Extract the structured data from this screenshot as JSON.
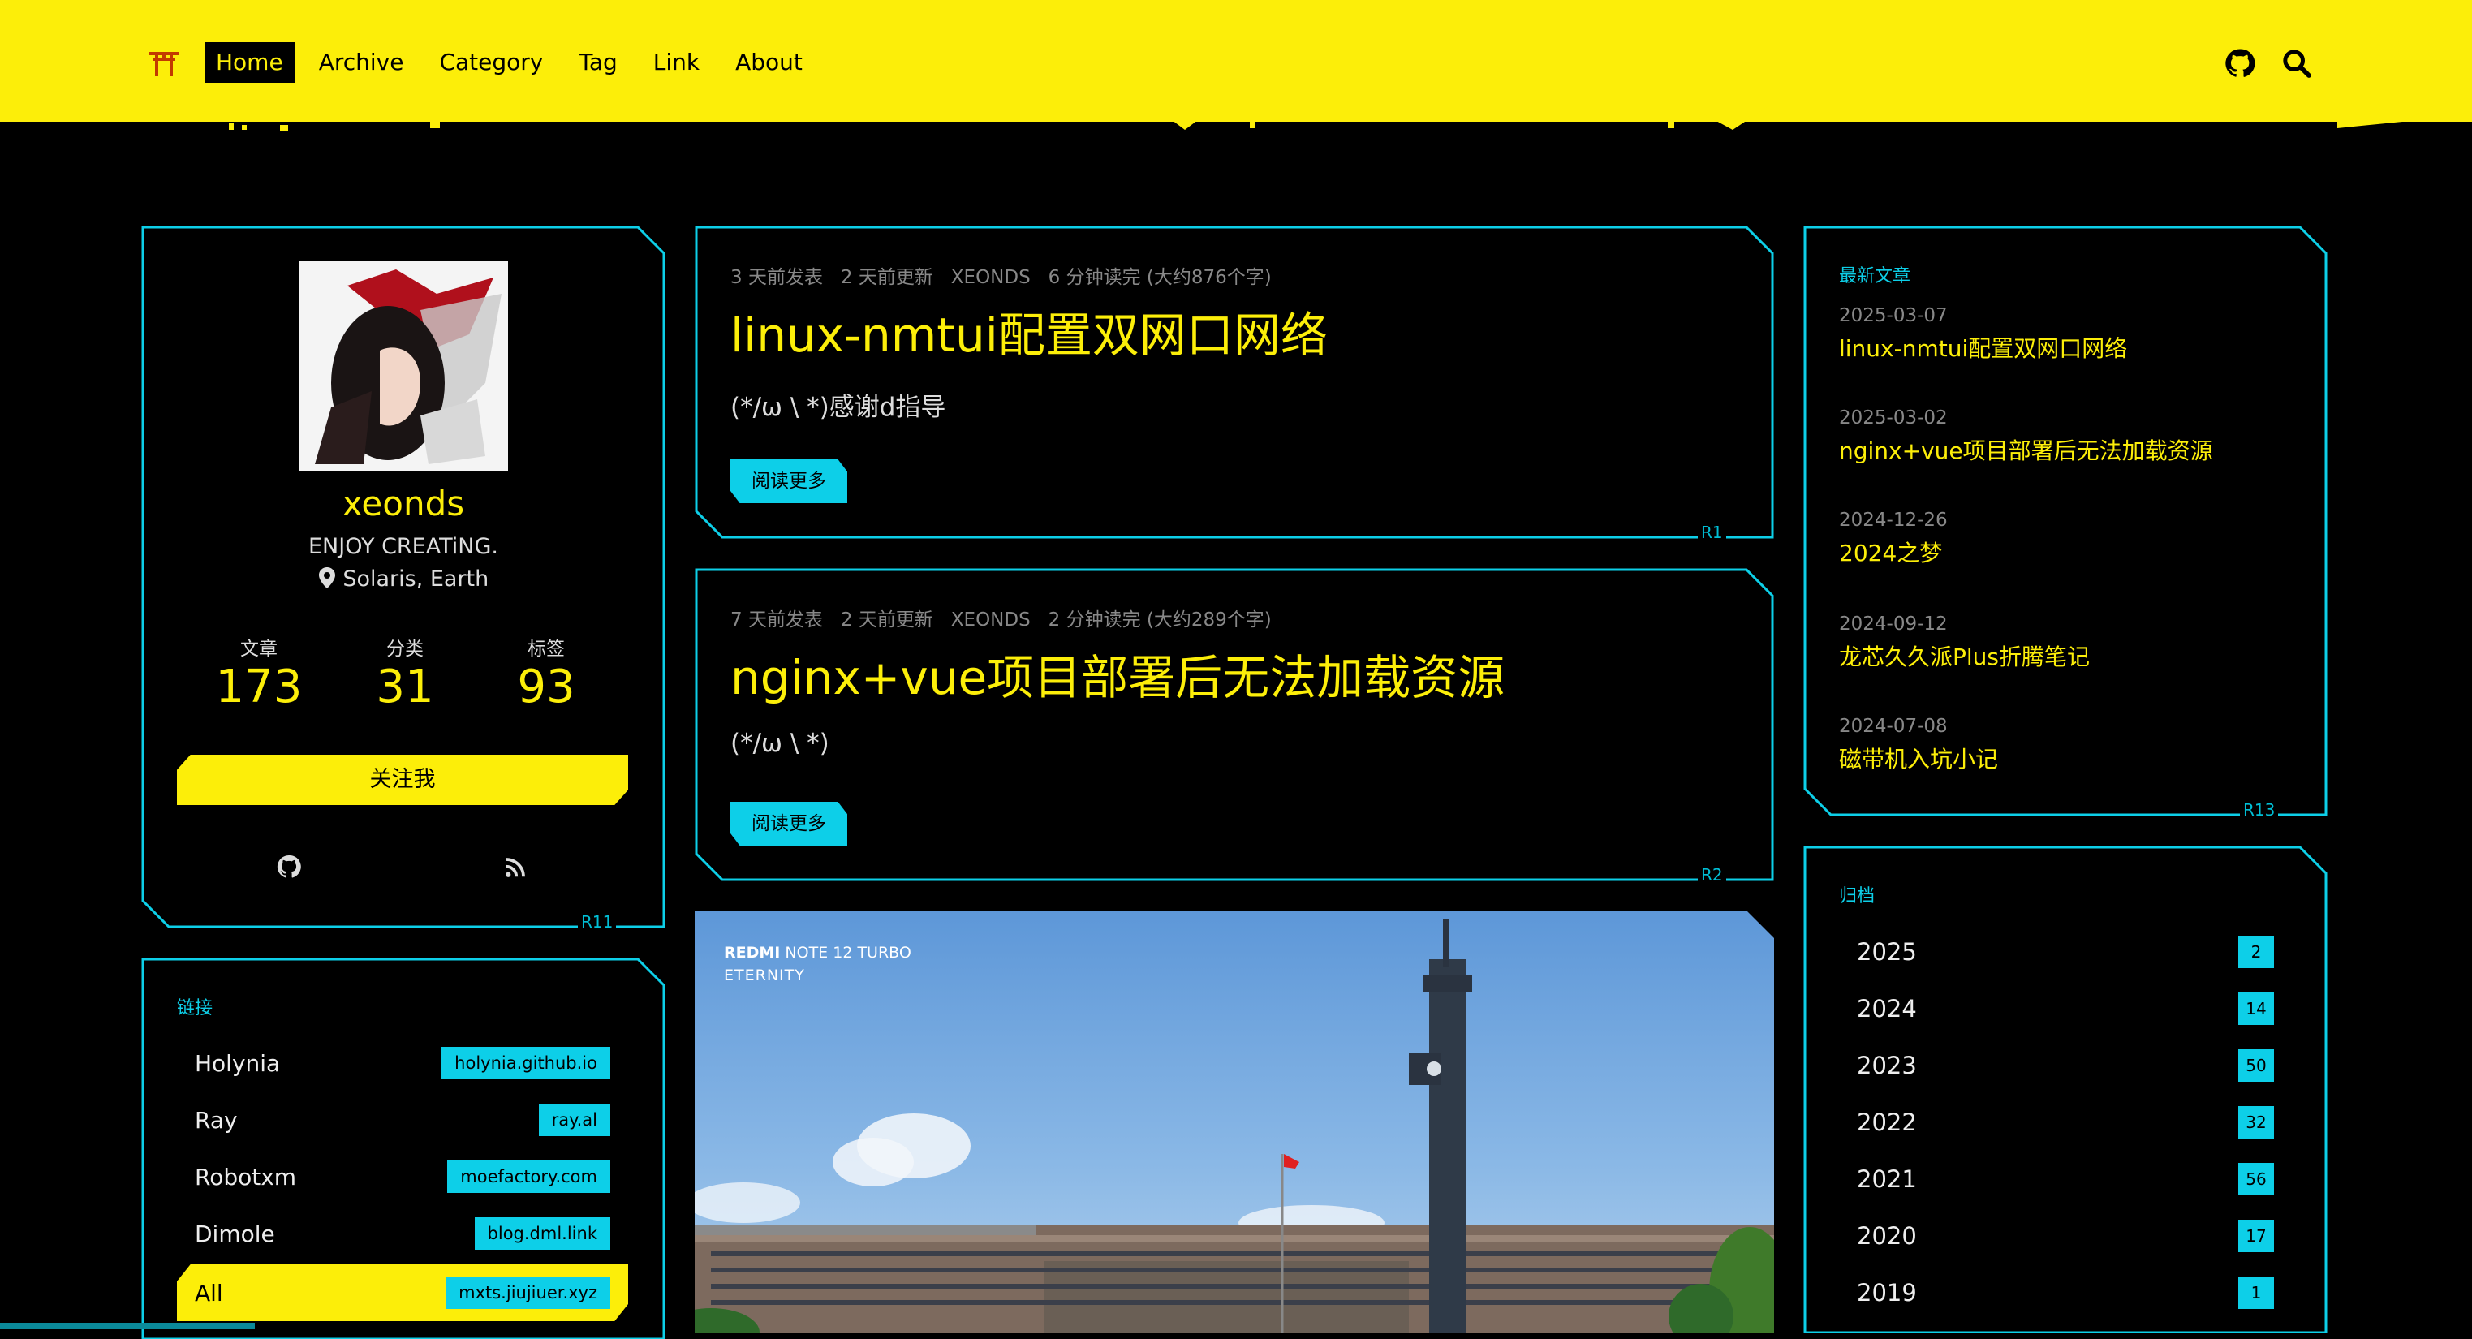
{
  "nav": {
    "items": [
      {
        "label": "Home",
        "active": true
      },
      {
        "label": "Archive"
      },
      {
        "label": "Category"
      },
      {
        "label": "Tag"
      },
      {
        "label": "Link"
      },
      {
        "label": "About"
      }
    ]
  },
  "profile": {
    "name": "xeonds",
    "motto": "ENJOY CREATiNG.",
    "location": "Solaris, Earth",
    "stats": [
      {
        "label": "文章",
        "value": "173"
      },
      {
        "label": "分类",
        "value": "31"
      },
      {
        "label": "标签",
        "value": "93"
      }
    ],
    "follow_label": "关注我",
    "tag": "R11"
  },
  "links": {
    "title": "链接",
    "items": [
      {
        "name": "Holynia",
        "url": "holynia.github.io"
      },
      {
        "name": "Ray",
        "url": "ray.al"
      },
      {
        "name": "Robotxm",
        "url": "moefactory.com"
      },
      {
        "name": "Dimole",
        "url": "blog.dml.link"
      },
      {
        "name": "All",
        "url": "mxts.jiujiuer.xyz"
      }
    ]
  },
  "posts": [
    {
      "published": "3 天前发表",
      "updated": "2 天前更新",
      "author": "XEONDS",
      "reading": "6 分钟读完 (大约876个字)",
      "title": "linux-nmtui配置双网口网络",
      "excerpt": "(*/ω \\ *)感谢d指导",
      "more": "阅读更多",
      "tag": "R1"
    },
    {
      "published": "7 天前发表",
      "updated": "2 天前更新",
      "author": "XEONDS",
      "reading": "2 分钟读完 (大约289个字)",
      "title": "nginx+vue项目部署后无法加载资源",
      "excerpt": "(*/ω \\ *)",
      "more": "阅读更多",
      "tag": "R2"
    }
  ],
  "photo": {
    "brand": "REDMI",
    "model": "NOTE 12 TURBO",
    "subtitle": "ETERNITY"
  },
  "recent": {
    "title": "最新文章",
    "items": [
      {
        "date": "2025-03-07",
        "title": "linux-nmtui配置双网口网络"
      },
      {
        "date": "2025-03-02",
        "title": "nginx+vue项目部署后无法加载资源"
      },
      {
        "date": "2024-12-26",
        "title": "2024之梦"
      },
      {
        "date": "2024-09-12",
        "title": "龙芯久久派Plus折腾笔记"
      },
      {
        "date": "2024-07-08",
        "title": "磁带机入坑小记"
      }
    ],
    "tag": "R13"
  },
  "archive": {
    "title": "归档",
    "items": [
      {
        "year": "2025",
        "count": "2"
      },
      {
        "year": "2024",
        "count": "14"
      },
      {
        "year": "2023",
        "count": "50"
      },
      {
        "year": "2022",
        "count": "32"
      },
      {
        "year": "2021",
        "count": "56"
      },
      {
        "year": "2020",
        "count": "17"
      },
      {
        "year": "2019",
        "count": "1"
      }
    ]
  },
  "colors": {
    "accent": "#fcee09",
    "cyan": "#0dcfe8",
    "bg": "#000000"
  }
}
